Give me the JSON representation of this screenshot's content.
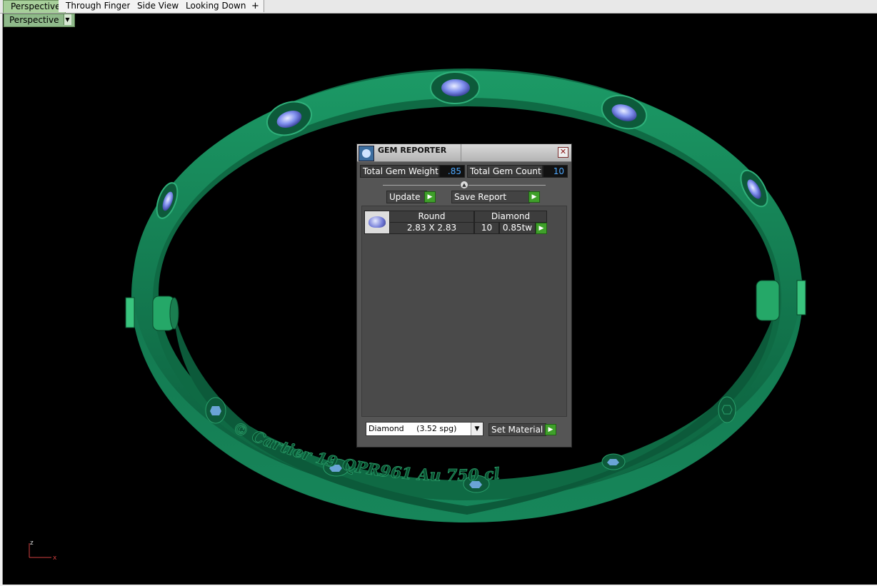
{
  "tabs": [
    {
      "label": "Perspective",
      "active": true
    },
    {
      "label": "Through Finger",
      "active": false
    },
    {
      "label": "Side View",
      "active": false
    },
    {
      "label": "Looking Down",
      "active": false
    }
  ],
  "add_tab_glyph": "+",
  "viewport": {
    "label": "Perspective",
    "dropdown_glyph": "▼",
    "engraving": "© Cartier 19 QPR961 Au 750 cl",
    "colors": {
      "background": "#000000",
      "ring": "#1a8c5c",
      "gem": "#7e8eea"
    }
  },
  "gem_reporter": {
    "title": "GEM REPORTER",
    "close_glyph": "✕",
    "total_weight_label": "Total Gem Weight",
    "total_weight_value": ".85",
    "total_count_label": "Total Gem Count",
    "total_count_value": "10",
    "update_label": "Update",
    "save_report_label": "Save Report",
    "go_glyph": "▶",
    "table": {
      "shape": "Round",
      "size": "2.83 X 2.83",
      "material": "Diamond",
      "count": "10",
      "weight": "0.85tw"
    },
    "material_select": {
      "value": "Diamond     (3.52 spg)",
      "dropdown_glyph": "▼"
    },
    "set_material_label": "Set Material"
  },
  "axis": {
    "z": "z",
    "x": "x"
  }
}
